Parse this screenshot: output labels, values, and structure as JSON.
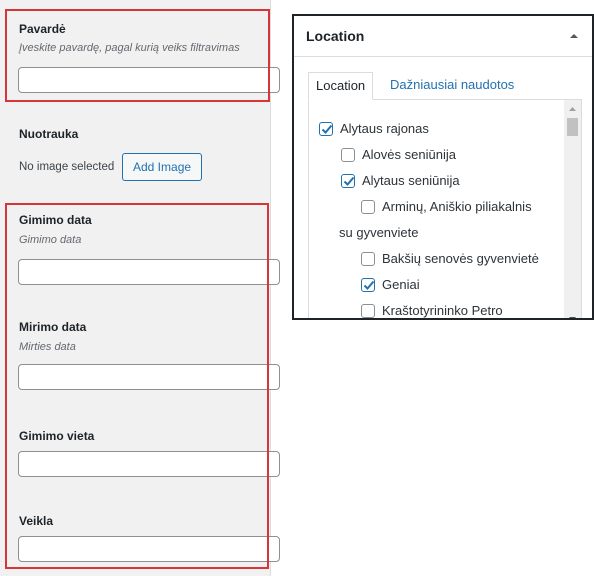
{
  "form": {
    "pavarde": {
      "label": "Pavardė",
      "description": "Įveskite pavardę, pagal kurią veiks filtravimas",
      "value": ""
    },
    "nuotrauka": {
      "label": "Nuotrauka",
      "status": "No image selected",
      "button": "Add Image"
    },
    "gimimo_data": {
      "label": "Gimimo data",
      "description": "Gimimo data",
      "value": ""
    },
    "mirimo_data": {
      "label": "Mirimo data",
      "description": "Mirties data",
      "value": ""
    },
    "gimimo_vieta": {
      "label": "Gimimo vieta",
      "value": ""
    },
    "veikla": {
      "label": "Veikla",
      "value": ""
    }
  },
  "location": {
    "title": "Location",
    "tabs": [
      "Location",
      "Dažniausiai naudotos"
    ],
    "items": [
      {
        "label": "Alytaus rajonas",
        "checked": true
      },
      {
        "label": "Alovės seniūnija",
        "checked": false
      },
      {
        "label": "Alytaus seniūnija",
        "checked": true
      },
      {
        "label": "Arminų, Aniškio piliakalnis",
        "label_cont": "su gyvenviete",
        "checked": false
      },
      {
        "label": "Bakšių senovės gyvenvietė",
        "checked": false
      },
      {
        "label": "Geniai",
        "checked": true
      },
      {
        "label": "Kraštotyrininko Petro",
        "checked": false
      }
    ]
  },
  "colors": {
    "highlight": "#d63638",
    "accent": "#2271b1"
  }
}
